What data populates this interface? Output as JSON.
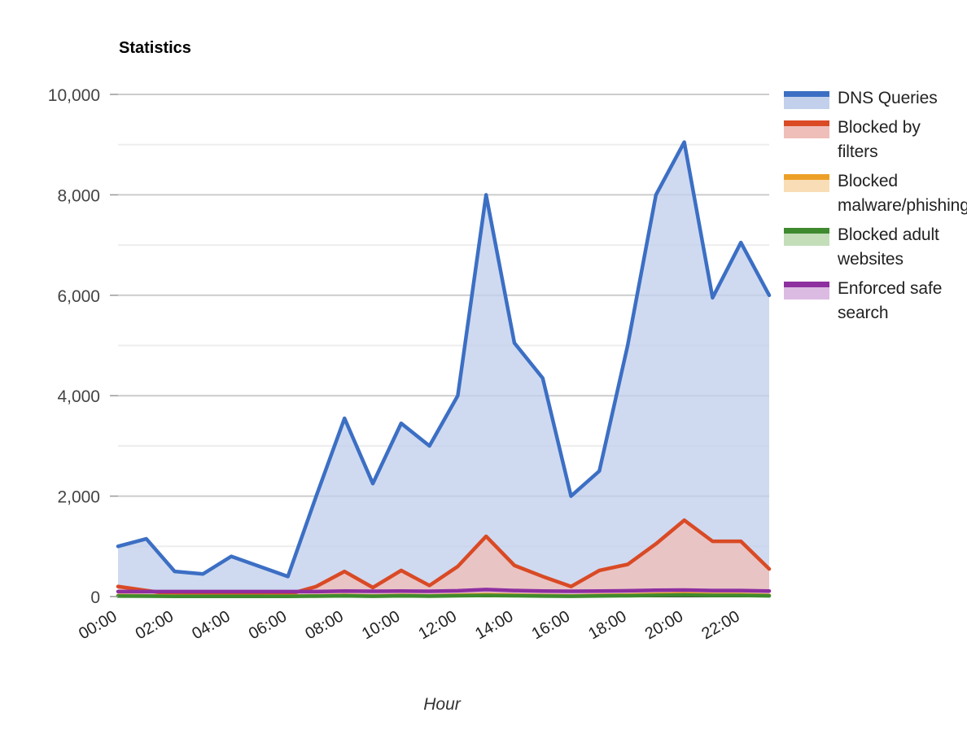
{
  "chart_data": {
    "type": "area",
    "title": "Statistics",
    "xlabel": "Hour",
    "ylabel": "",
    "grid": true,
    "legend_position": "right",
    "ylim": [
      0,
      10000
    ],
    "ytick_labels": [
      "10,000",
      "8,000",
      "6,000",
      "4,000",
      "2,000",
      "0"
    ],
    "ytick_values": [
      10000,
      8000,
      6000,
      4000,
      2000,
      0
    ],
    "minor_gridline_values": [
      9000,
      7000,
      5000,
      3000,
      1000
    ],
    "categories": [
      "00:00",
      "01:00",
      "02:00",
      "03:00",
      "04:00",
      "05:00",
      "06:00",
      "07:00",
      "08:00",
      "09:00",
      "10:00",
      "11:00",
      "12:00",
      "13:00",
      "14:00",
      "15:00",
      "16:00",
      "17:00",
      "18:00",
      "19:00",
      "20:00",
      "21:00",
      "22:00",
      "23:00"
    ],
    "xtick_labels": [
      "00:00",
      "02:00",
      "04:00",
      "06:00",
      "08:00",
      "10:00",
      "12:00",
      "14:00",
      "16:00",
      "18:00",
      "20:00",
      "22:00"
    ],
    "xtick_indices": [
      0,
      2,
      4,
      6,
      8,
      10,
      12,
      14,
      16,
      18,
      20,
      22
    ],
    "xtick_rotation": -30,
    "series": [
      {
        "name": "DNS Queries",
        "color": "#3c6fc4",
        "fill": "#c2d0ec",
        "values": [
          1000,
          1150,
          500,
          450,
          800,
          600,
          400,
          2000,
          3550,
          2250,
          3450,
          3000,
          4000,
          8000,
          5050,
          4350,
          2000,
          2500,
          5000,
          8000,
          9050,
          5950,
          7050,
          6000
        ]
      },
      {
        "name": "Blocked by filters",
        "color": "#d94a25",
        "fill": "#efbeb9",
        "values": [
          200,
          120,
          40,
          30,
          30,
          30,
          40,
          200,
          500,
          180,
          520,
          220,
          600,
          1200,
          620,
          400,
          200,
          520,
          640,
          1050,
          1520,
          1100,
          1100,
          550
        ]
      },
      {
        "name": "Blocked malware/phishing",
        "color": "#eda028",
        "fill": "#f9ddb6",
        "values": [
          20,
          15,
          10,
          8,
          8,
          8,
          10,
          15,
          25,
          12,
          25,
          14,
          28,
          40,
          30,
          20,
          12,
          24,
          30,
          45,
          55,
          40,
          40,
          25
        ]
      },
      {
        "name": "Blocked adult websites",
        "color": "#3f8a2e",
        "fill": "#c3deb9",
        "values": [
          10,
          8,
          5,
          4,
          4,
          4,
          5,
          8,
          14,
          6,
          14,
          8,
          16,
          22,
          16,
          11,
          6,
          13,
          17,
          25,
          30,
          22,
          22,
          14
        ]
      },
      {
        "name": "Enforced safe search",
        "color": "#8e2fa0",
        "fill": "#dcbbe2",
        "values": [
          100,
          100,
          100,
          100,
          100,
          100,
          100,
          100,
          110,
          105,
          110,
          105,
          115,
          140,
          120,
          110,
          105,
          110,
          115,
          125,
          130,
          120,
          120,
          110
        ]
      }
    ]
  },
  "legend": {
    "items": [
      {
        "label": "DNS Queries"
      },
      {
        "label": "Blocked by filters"
      },
      {
        "label": "Blocked malware/phishing"
      },
      {
        "label": "Blocked adult websites"
      },
      {
        "label": "Enforced safe search"
      }
    ]
  }
}
